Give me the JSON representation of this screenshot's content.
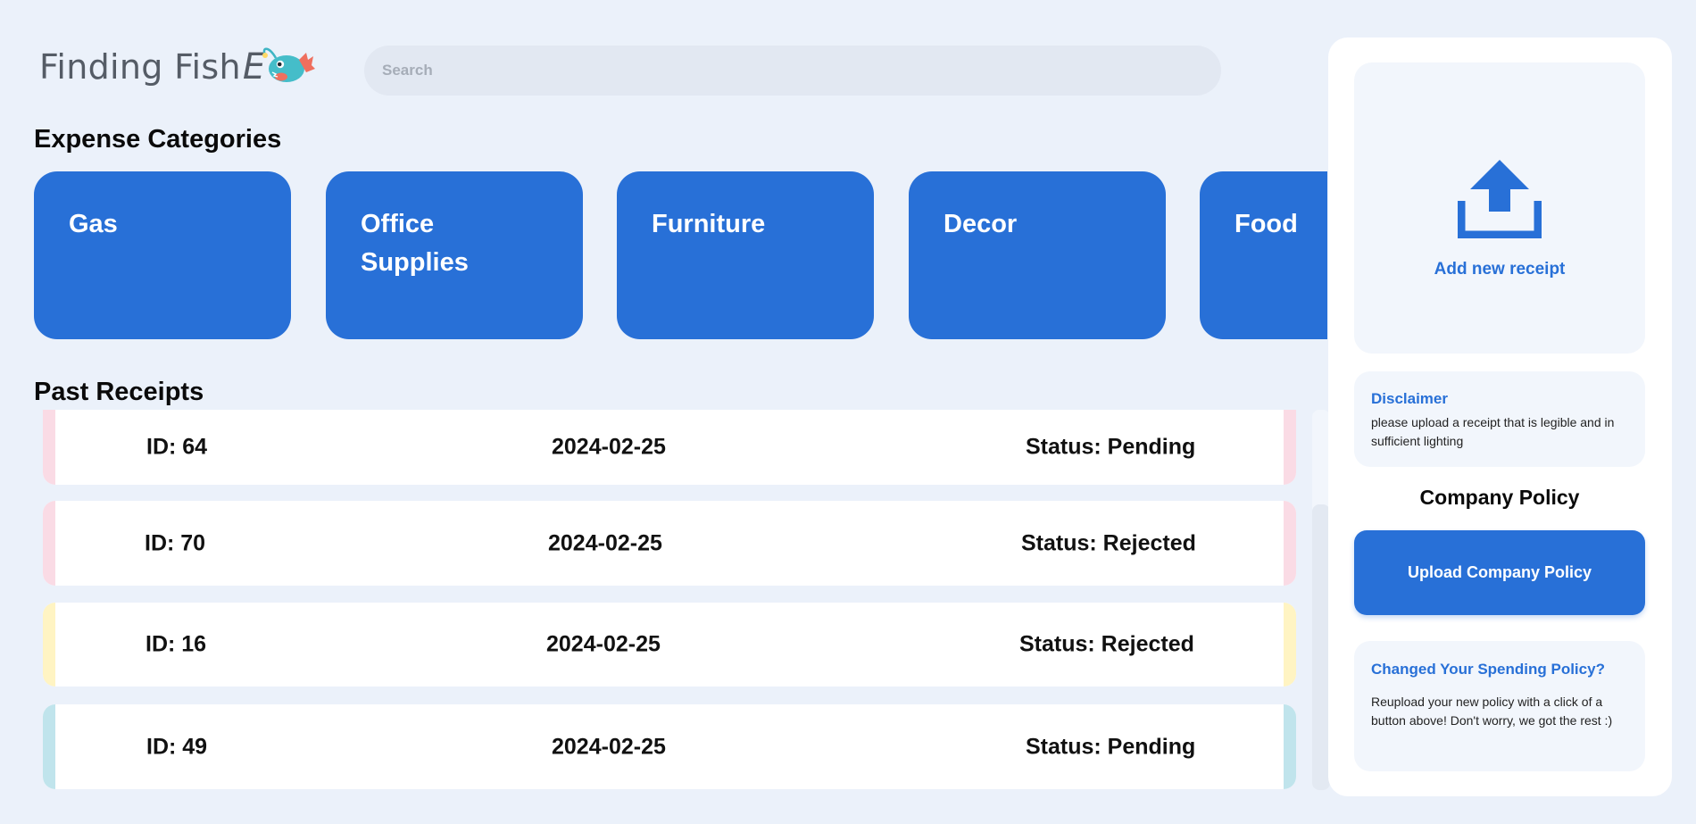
{
  "app": {
    "logo_text": "Finding Fish",
    "logo_suffix": "E"
  },
  "search": {
    "placeholder": "Search",
    "value": ""
  },
  "categories": {
    "title": "Expense Categories",
    "items": [
      {
        "label": "Gas"
      },
      {
        "label": "Office Supplies"
      },
      {
        "label": "Furniture"
      },
      {
        "label": "Decor"
      },
      {
        "label": "Food"
      }
    ]
  },
  "receipts": {
    "title": "Past Receipts",
    "items": [
      {
        "id": "ID: 64",
        "date": "2024-02-25",
        "status": "Status: Pending",
        "accent": "#fadbe5"
      },
      {
        "id": "ID: 70",
        "date": "2024-02-25",
        "status": "Status: Rejected",
        "accent": "#fadbe5"
      },
      {
        "id": "ID: 16",
        "date": "2024-02-25",
        "status": "Status: Rejected",
        "accent": "#fff4c3"
      },
      {
        "id": "ID: 49",
        "date": "2024-02-25",
        "status": "Status: Pending",
        "accent": "#c0e4ec"
      }
    ]
  },
  "sidebar": {
    "upload_label": "Add new receipt",
    "disclaimer_title": "Disclaimer",
    "disclaimer_text": "please upload a receipt that is legible and in sufficient lighting",
    "policy_title": "Company Policy",
    "policy_button": "Upload Company Policy",
    "changed_title": "Changed Your Spending Policy?",
    "changed_text": "Reupload your new policy with a click of a button above! Don't worry, we got the rest :)"
  },
  "colors": {
    "accent": "#2870d7",
    "background": "#ebf1fa"
  }
}
